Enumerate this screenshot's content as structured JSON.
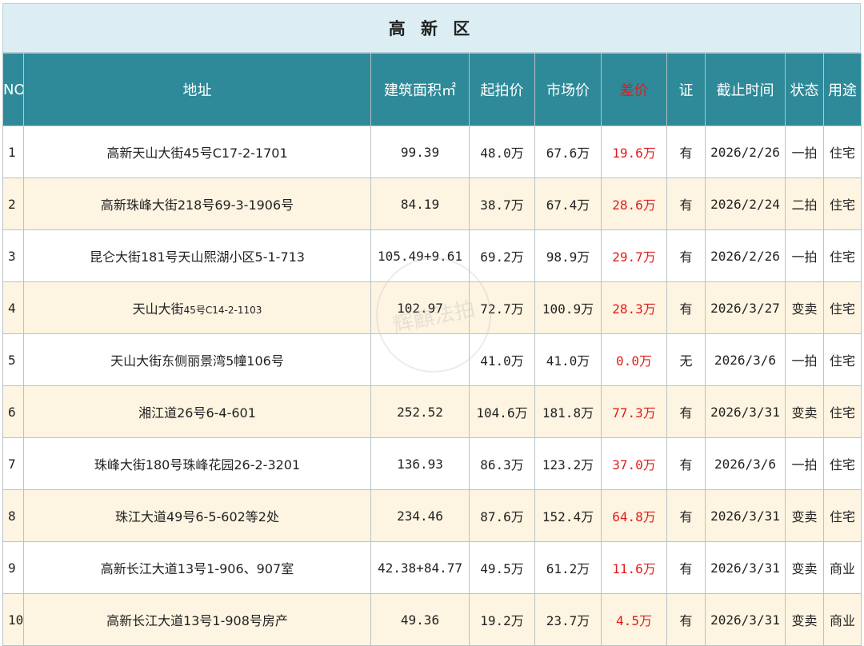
{
  "title": "高 新 区",
  "headers": {
    "no": "NO",
    "address": "地址",
    "area": "建筑面积㎡",
    "start_price": "起拍价",
    "market_price": "市场价",
    "diff": "差价",
    "cert": "证",
    "deadline": "截止时间",
    "status": "状态",
    "usage": "用途"
  },
  "rows": [
    {
      "no": "1",
      "addr_main": "高新天山大街45号C17-2-1701",
      "addr_small": "",
      "area": "99.39",
      "start": "48.0万",
      "market": "67.6万",
      "diff": "19.6万",
      "cert": "有",
      "deadline": "2026/2/26",
      "status": "一拍",
      "usage": "住宅"
    },
    {
      "no": "2",
      "addr_main": "高新珠峰大街218号69-3-1906号",
      "addr_small": "",
      "area": "84.19",
      "start": "38.7万",
      "market": "67.4万",
      "diff": "28.6万",
      "cert": "有",
      "deadline": "2026/2/24",
      "status": "二拍",
      "usage": "住宅"
    },
    {
      "no": "3",
      "addr_main": "昆仑大街181号天山熙湖小区5-1-713",
      "addr_small": "",
      "area": "105.49+9.61",
      "start": "69.2万",
      "market": "98.9万",
      "diff": "29.7万",
      "cert": "有",
      "deadline": "2026/2/26",
      "status": "一拍",
      "usage": "住宅"
    },
    {
      "no": "4",
      "addr_main": "天山大街",
      "addr_small": "45号C14-2-1103",
      "area": "102.97",
      "start": "72.7万",
      "market": "100.9万",
      "diff": "28.3万",
      "cert": "有",
      "deadline": "2026/3/27",
      "status": "变卖",
      "usage": "住宅"
    },
    {
      "no": "5",
      "addr_main": "天山大街东侧丽景湾5幢106号",
      "addr_small": "",
      "area": "",
      "start": "41.0万",
      "market": "41.0万",
      "diff": "0.0万",
      "cert": "无",
      "deadline": "2026/3/6",
      "status": "一拍",
      "usage": "住宅"
    },
    {
      "no": "6",
      "addr_main": "湘江道26号6-4-601",
      "addr_small": "",
      "area": "252.52",
      "start": "104.6万",
      "market": "181.8万",
      "diff": "77.3万",
      "cert": "有",
      "deadline": "2026/3/31",
      "status": "变卖",
      "usage": "住宅"
    },
    {
      "no": "7",
      "addr_main": "珠峰大街180号珠峰花园26-2-3201",
      "addr_small": "",
      "area": "136.93",
      "start": "86.3万",
      "market": "123.2万",
      "diff": "37.0万",
      "cert": "有",
      "deadline": "2026/3/6",
      "status": "一拍",
      "usage": "住宅"
    },
    {
      "no": "8",
      "addr_main": "珠江大道49号6-5-602等2处",
      "addr_small": "",
      "area": "234.46",
      "start": "87.6万",
      "market": "152.4万",
      "diff": "64.8万",
      "cert": "有",
      "deadline": "2026/3/31",
      "status": "变卖",
      "usage": "住宅"
    },
    {
      "no": "9",
      "addr_main": "高新长江大道13号1-906、907室",
      "addr_small": "",
      "area": "42.38+84.77",
      "start": "49.5万",
      "market": "61.2万",
      "diff": "11.6万",
      "cert": "有",
      "deadline": "2026/3/31",
      "status": "变卖",
      "usage": "商业"
    },
    {
      "no": "10",
      "addr_main": "高新长江大道13号1-908号房产",
      "addr_small": "",
      "area": "49.36",
      "start": "19.2万",
      "market": "23.7万",
      "diff": "4.5万",
      "cert": "有",
      "deadline": "2026/3/31",
      "status": "变卖",
      "usage": "商业"
    }
  ],
  "watermark": "辉麒法拍",
  "colors": {
    "header_bg": "#2e8a99",
    "title_bg": "#dceef4",
    "diff_red": "#e31b1b",
    "stripe": "#fdf4e1"
  }
}
